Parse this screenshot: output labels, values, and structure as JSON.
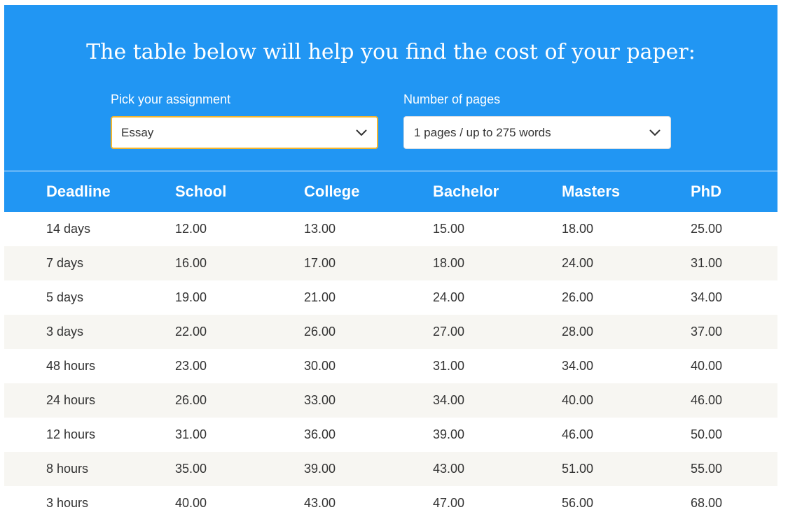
{
  "header": {
    "title": "The table below will help you find the cost of your paper:"
  },
  "filters": {
    "assignment_label": "Pick your assignment",
    "assignment_value": "Essay",
    "pages_label": "Number of pages",
    "pages_value": "1 pages / up to 275 words"
  },
  "icons": {
    "chevron": "chevron-down-icon"
  },
  "colors": {
    "primary": "#2196f3",
    "focus_border": "#f2b52e",
    "row_alt": "#f7f6f2",
    "text": "#333333"
  },
  "table": {
    "columns": [
      "Deadline",
      "School",
      "College",
      "Bachelor",
      "Masters",
      "PhD"
    ],
    "rows": [
      [
        "14 days",
        "12.00",
        "13.00",
        "15.00",
        "18.00",
        "25.00"
      ],
      [
        "7 days",
        "16.00",
        "17.00",
        "18.00",
        "24.00",
        "31.00"
      ],
      [
        "5 days",
        "19.00",
        "21.00",
        "24.00",
        "26.00",
        "34.00"
      ],
      [
        "3 days",
        "22.00",
        "26.00",
        "27.00",
        "28.00",
        "37.00"
      ],
      [
        "48 hours",
        "23.00",
        "30.00",
        "31.00",
        "34.00",
        "40.00"
      ],
      [
        "24 hours",
        "26.00",
        "33.00",
        "34.00",
        "40.00",
        "46.00"
      ],
      [
        "12 hours",
        "31.00",
        "36.00",
        "39.00",
        "46.00",
        "50.00"
      ],
      [
        "8 hours",
        "35.00",
        "39.00",
        "43.00",
        "51.00",
        "55.00"
      ],
      [
        "3 hours",
        "40.00",
        "43.00",
        "47.00",
        "56.00",
        "68.00"
      ]
    ]
  }
}
